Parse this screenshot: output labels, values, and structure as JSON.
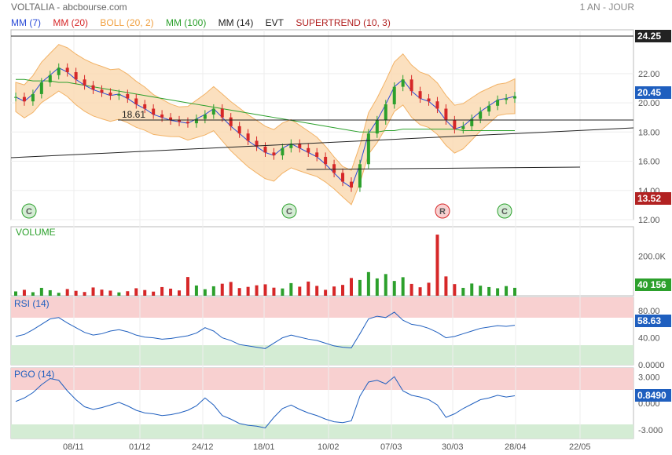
{
  "header": {
    "title": "VOLTALIA - abcbourse.com",
    "period": "1 AN - JOUR"
  },
  "legend": [
    {
      "label": "MM (7)",
      "color": "#2a4bd7"
    },
    {
      "label": "MM (20)",
      "color": "#d62728"
    },
    {
      "label": "BOLL (20, 2)",
      "color": "#f0a040"
    },
    {
      "label": "MM (100)",
      "color": "#2ca02c"
    },
    {
      "label": "MM (14)",
      "color": "#222222"
    },
    {
      "label": "EVT",
      "color": "#222222"
    },
    {
      "label": "SUPERTREND (10, 3)",
      "color": "#b22222"
    }
  ],
  "markers": [
    {
      "label": "C",
      "x": "08/11-early",
      "color": "#2ca02c"
    },
    {
      "label": "C",
      "x": "18/01-late",
      "color": "#2ca02c"
    },
    {
      "label": "R",
      "x": "20/03",
      "color": "#d62728"
    },
    {
      "label": "C",
      "x": "20/04",
      "color": "#2ca02c"
    }
  ],
  "annotations": {
    "level_label": "18.61"
  },
  "price_tags": [
    {
      "value": "24.25",
      "color": "#222222"
    },
    {
      "value": "20.45",
      "color": "#1f5fbf"
    },
    {
      "value": "13.52",
      "color": "#b22222"
    }
  ],
  "panels": {
    "volume": {
      "label": "VOLUME",
      "last": "40 156",
      "last_color": "#2ca02c"
    },
    "rsi": {
      "label": "RSI (14)",
      "last": "58.63",
      "last_color": "#1f5fbf"
    },
    "pgo": {
      "label": "PGO (14)",
      "last": "0.8490",
      "last_color": "#1f5fbf"
    }
  },
  "chart_data": [
    {
      "type": "line",
      "title": "VOLTALIA",
      "x_ticks": [
        "08/11",
        "01/12",
        "24/12",
        "18/01",
        "10/02",
        "07/03",
        "30/03",
        "28/04",
        "22/05"
      ],
      "y_ticks": [
        "12.00",
        "14.00",
        "16.00",
        "18.00",
        "20.00",
        "22.00"
      ],
      "ylim": [
        12,
        25
      ],
      "grid": true,
      "series": [
        {
          "name": "Close",
          "values": [
            20.4,
            20.1,
            20.6,
            21.4,
            21.9,
            22.4,
            22.1,
            21.6,
            21.2,
            20.9,
            20.7,
            20.5,
            20.6,
            20.3,
            19.9,
            19.6,
            19.2,
            19.0,
            18.8,
            18.7,
            18.6,
            18.9,
            19.2,
            19.6,
            19.0,
            18.4,
            17.9,
            17.4,
            17.0,
            16.6,
            16.4,
            16.9,
            17.2,
            16.9,
            16.6,
            16.3,
            15.8,
            15.2,
            14.6,
            14.2,
            15.8,
            17.9,
            18.8,
            19.9,
            21.1,
            21.6,
            20.8,
            20.3,
            20.1,
            19.6,
            18.8,
            18.2,
            18.4,
            18.9,
            19.4,
            19.8,
            20.2,
            20.3,
            20.45
          ]
        },
        {
          "name": "MM (100)",
          "values": [
            21.6,
            21.6,
            21.5,
            21.5,
            21.5,
            21.4,
            21.4,
            21.3,
            21.2,
            21.1,
            21.0,
            20.9,
            20.8,
            20.7,
            20.6,
            20.5,
            20.4,
            20.3,
            20.2,
            20.1,
            20.0,
            19.9,
            19.8,
            19.7,
            19.6,
            19.5,
            19.4,
            19.3,
            19.2,
            19.1,
            19.0,
            18.9,
            18.8,
            18.7,
            18.6,
            18.5,
            18.4,
            18.3,
            18.2,
            18.1,
            18.0,
            18.0,
            18.0,
            18.1,
            18.1,
            18.2,
            18.2,
            18.2,
            18.2,
            18.2,
            18.2,
            18.2,
            18.1,
            18.1,
            18.1,
            18.1,
            18.1,
            18.1,
            18.1
          ]
        }
      ]
    },
    {
      "type": "bar",
      "title": "VOLUME",
      "y_ticks": [
        "200.0K"
      ],
      "ylim": [
        0,
        350000
      ],
      "values": [
        22000,
        30000,
        18000,
        40000,
        28000,
        15000,
        34000,
        25000,
        19000,
        42000,
        31000,
        26000,
        17000,
        23000,
        38000,
        29000,
        21000,
        44000,
        36000,
        27000,
        95000,
        52000,
        33000,
        48000,
        61000,
        70000,
        39000,
        45000,
        53000,
        58000,
        41000,
        37000,
        64000,
        46000,
        72000,
        50000,
        30000,
        47000,
        55000,
        90000,
        80000,
        120000,
        88000,
        110000,
        75000,
        94000,
        60000,
        43000,
        66000,
        310000,
        98000,
        59000,
        40000,
        62000,
        51000,
        44000,
        38000,
        49000,
        40156
      ]
    },
    {
      "type": "line",
      "title": "RSI (14)",
      "y_ticks": [
        "80.00",
        "40.00",
        "0.0000"
      ],
      "ylim": [
        0,
        100
      ],
      "values": [
        42,
        45,
        52,
        60,
        68,
        70,
        62,
        55,
        48,
        44,
        46,
        50,
        52,
        49,
        44,
        41,
        40,
        38,
        39,
        41,
        43,
        47,
        55,
        50,
        40,
        36,
        30,
        28,
        26,
        24,
        32,
        40,
        44,
        41,
        38,
        36,
        32,
        28,
        26,
        25,
        46,
        68,
        72,
        70,
        78,
        66,
        60,
        58,
        54,
        48,
        40,
        42,
        46,
        50,
        54,
        56,
        58,
        57,
        58.63
      ]
    },
    {
      "type": "line",
      "title": "PGO (14)",
      "y_ticks": [
        "3.000",
        "0.000",
        "-3.000"
      ],
      "ylim": [
        -4,
        4
      ],
      "values": [
        0.2,
        0.6,
        1.2,
        2.1,
        2.8,
        2.6,
        1.4,
        0.4,
        -0.4,
        -0.7,
        -0.5,
        -0.2,
        0.1,
        -0.3,
        -0.8,
        -1.1,
        -1.2,
        -1.4,
        -1.3,
        -1.1,
        -0.8,
        -0.3,
        0.6,
        -0.2,
        -1.4,
        -1.8,
        -2.3,
        -2.5,
        -2.6,
        -2.8,
        -1.6,
        -0.6,
        -0.2,
        -0.7,
        -1.1,
        -1.4,
        -1.8,
        -2.1,
        -2.2,
        -2.0,
        0.8,
        2.4,
        2.6,
        2.2,
        3.0,
        1.4,
        0.9,
        0.7,
        0.4,
        -0.2,
        -1.6,
        -1.2,
        -0.6,
        -0.1,
        0.4,
        0.6,
        0.9,
        0.7,
        0.849
      ]
    }
  ]
}
